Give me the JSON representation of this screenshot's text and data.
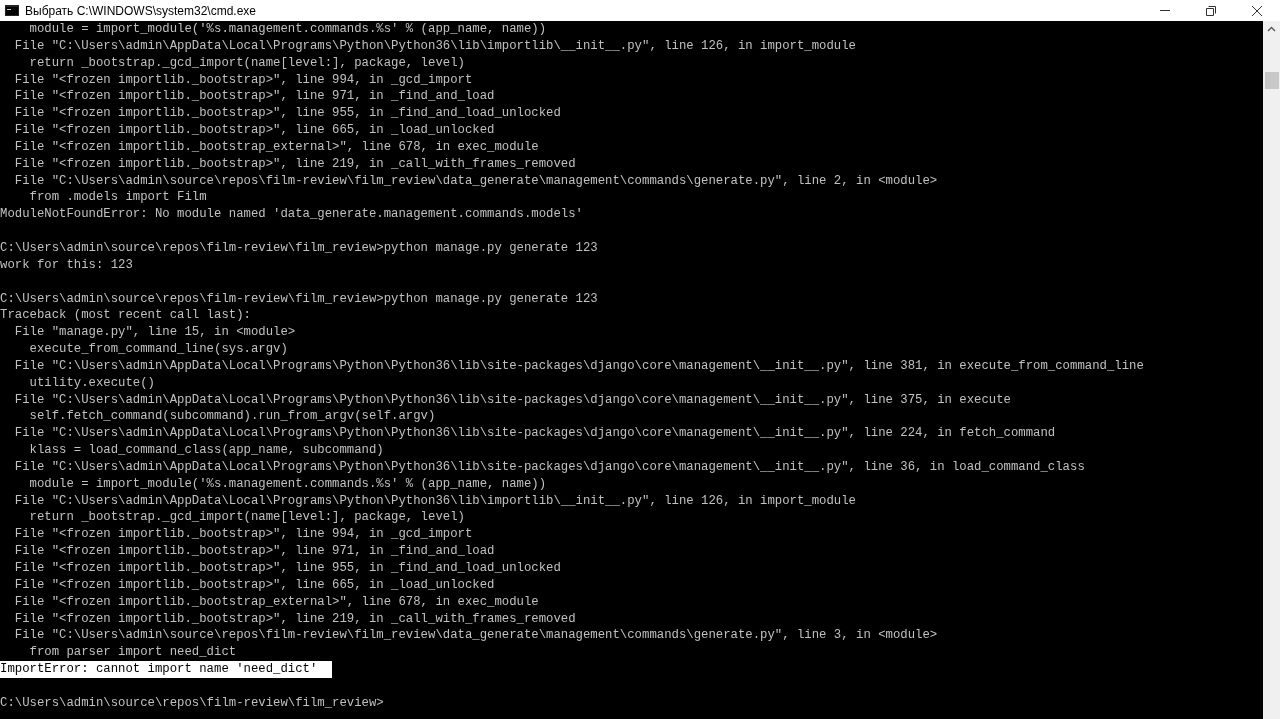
{
  "window": {
    "title": "Выбрать C:\\WINDOWS\\system32\\cmd.exe"
  },
  "lines": [
    {
      "kind": "text",
      "text": "    module = import_module('%s.management.commands.%s' % (app_name, name))",
      "selected": false
    },
    {
      "kind": "text",
      "text": "  File \"C:\\Users\\admin\\AppData\\Local\\Programs\\Python\\Python36\\lib\\importlib\\__init__.py\", line 126, in import_module",
      "selected": false
    },
    {
      "kind": "text",
      "text": "    return _bootstrap._gcd_import(name[level:], package, level)",
      "selected": false
    },
    {
      "kind": "text",
      "text": "  File \"<frozen importlib._bootstrap>\", line 994, in _gcd_import",
      "selected": false
    },
    {
      "kind": "text",
      "text": "  File \"<frozen importlib._bootstrap>\", line 971, in _find_and_load",
      "selected": false
    },
    {
      "kind": "text",
      "text": "  File \"<frozen importlib._bootstrap>\", line 955, in _find_and_load_unlocked",
      "selected": false
    },
    {
      "kind": "text",
      "text": "  File \"<frozen importlib._bootstrap>\", line 665, in _load_unlocked",
      "selected": false
    },
    {
      "kind": "text",
      "text": "  File \"<frozen importlib._bootstrap_external>\", line 678, in exec_module",
      "selected": false
    },
    {
      "kind": "text",
      "text": "  File \"<frozen importlib._bootstrap>\", line 219, in _call_with_frames_removed",
      "selected": false
    },
    {
      "kind": "text",
      "text": "  File \"C:\\Users\\admin\\source\\repos\\film-review\\film_review\\data_generate\\management\\commands\\generate.py\", line 2, in <module>",
      "selected": false
    },
    {
      "kind": "text",
      "text": "    from .models import Film",
      "selected": false
    },
    {
      "kind": "text",
      "text": "ModuleNotFoundError: No module named 'data_generate.management.commands.models'",
      "selected": false
    },
    {
      "kind": "blank"
    },
    {
      "kind": "text",
      "text": "C:\\Users\\admin\\source\\repos\\film-review\\film_review>python manage.py generate 123",
      "selected": false
    },
    {
      "kind": "text",
      "text": "work for this: 123",
      "selected": false
    },
    {
      "kind": "blank"
    },
    {
      "kind": "text",
      "text": "C:\\Users\\admin\\source\\repos\\film-review\\film_review>python manage.py generate 123",
      "selected": false
    },
    {
      "kind": "text",
      "text": "Traceback (most recent call last):",
      "selected": false
    },
    {
      "kind": "text",
      "text": "  File \"manage.py\", line 15, in <module>",
      "selected": false
    },
    {
      "kind": "text",
      "text": "    execute_from_command_line(sys.argv)",
      "selected": false
    },
    {
      "kind": "text",
      "text": "  File \"C:\\Users\\admin\\AppData\\Local\\Programs\\Python\\Python36\\lib\\site-packages\\django\\core\\management\\__init__.py\", line 381, in execute_from_command_line",
      "selected": false
    },
    {
      "kind": "text",
      "text": "    utility.execute()",
      "selected": false
    },
    {
      "kind": "text",
      "text": "  File \"C:\\Users\\admin\\AppData\\Local\\Programs\\Python\\Python36\\lib\\site-packages\\django\\core\\management\\__init__.py\", line 375, in execute",
      "selected": false
    },
    {
      "kind": "text",
      "text": "    self.fetch_command(subcommand).run_from_argv(self.argv)",
      "selected": false
    },
    {
      "kind": "text",
      "text": "  File \"C:\\Users\\admin\\AppData\\Local\\Programs\\Python\\Python36\\lib\\site-packages\\django\\core\\management\\__init__.py\", line 224, in fetch_command",
      "selected": false
    },
    {
      "kind": "text",
      "text": "    klass = load_command_class(app_name, subcommand)",
      "selected": false
    },
    {
      "kind": "text",
      "text": "  File \"C:\\Users\\admin\\AppData\\Local\\Programs\\Python\\Python36\\lib\\site-packages\\django\\core\\management\\__init__.py\", line 36, in load_command_class",
      "selected": false
    },
    {
      "kind": "text",
      "text": "    module = import_module('%s.management.commands.%s' % (app_name, name))",
      "selected": false
    },
    {
      "kind": "text",
      "text": "  File \"C:\\Users\\admin\\AppData\\Local\\Programs\\Python\\Python36\\lib\\importlib\\__init__.py\", line 126, in import_module",
      "selected": false
    },
    {
      "kind": "text",
      "text": "    return _bootstrap._gcd_import(name[level:], package, level)",
      "selected": false
    },
    {
      "kind": "text",
      "text": "  File \"<frozen importlib._bootstrap>\", line 994, in _gcd_import",
      "selected": false
    },
    {
      "kind": "text",
      "text": "  File \"<frozen importlib._bootstrap>\", line 971, in _find_and_load",
      "selected": false
    },
    {
      "kind": "text",
      "text": "  File \"<frozen importlib._bootstrap>\", line 955, in _find_and_load_unlocked",
      "selected": false
    },
    {
      "kind": "text",
      "text": "  File \"<frozen importlib._bootstrap>\", line 665, in _load_unlocked",
      "selected": false
    },
    {
      "kind": "text",
      "text": "  File \"<frozen importlib._bootstrap_external>\", line 678, in exec_module",
      "selected": false
    },
    {
      "kind": "text",
      "text": "  File \"<frozen importlib._bootstrap>\", line 219, in _call_with_frames_removed",
      "selected": false
    },
    {
      "kind": "text",
      "text": "  File \"C:\\Users\\admin\\source\\repos\\film-review\\film_review\\data_generate\\management\\commands\\generate.py\", line 3, in <module>",
      "selected": false
    },
    {
      "kind": "text",
      "text": "    from parser import need_dict",
      "selected": false
    },
    {
      "kind": "text",
      "text": "ImportError: cannot import name 'need_dict'",
      "selected": true
    },
    {
      "kind": "blank"
    },
    {
      "kind": "text",
      "text": "C:\\Users\\admin\\source\\repos\\film-review\\film_review>",
      "selected": false
    }
  ]
}
